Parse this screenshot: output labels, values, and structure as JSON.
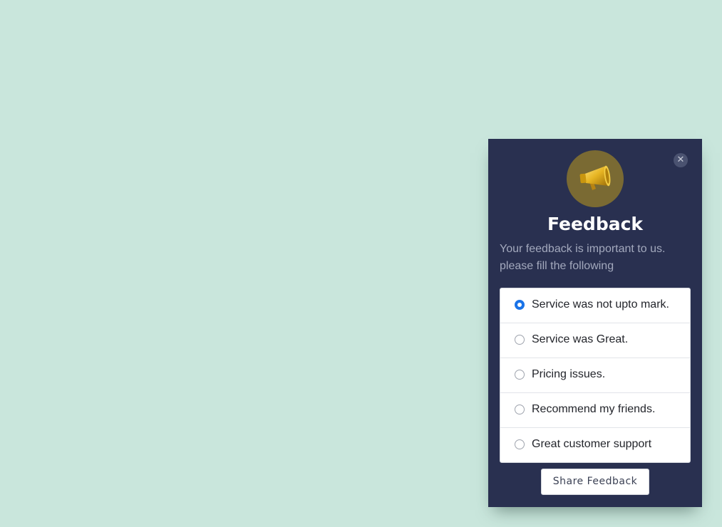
{
  "feedback_panel": {
    "icon": "megaphone-icon",
    "close_icon": "close-icon",
    "title": "Feedback",
    "subtitle": "Your feedback is important to us. please fill the following",
    "options": [
      {
        "label": "Service was not upto mark.",
        "selected": true
      },
      {
        "label": "Service was Great.",
        "selected": false
      },
      {
        "label": "Pricing issues.",
        "selected": false
      },
      {
        "label": "Recommend my friends.",
        "selected": false
      },
      {
        "label": "Great customer support",
        "selected": false
      }
    ],
    "submit_label": "Share Feedback"
  },
  "colors": {
    "page_background": "#c9e6dc",
    "panel_background": "#293050",
    "accent_radio": "#1a73e8",
    "avatar_background": "#7a6a33"
  }
}
